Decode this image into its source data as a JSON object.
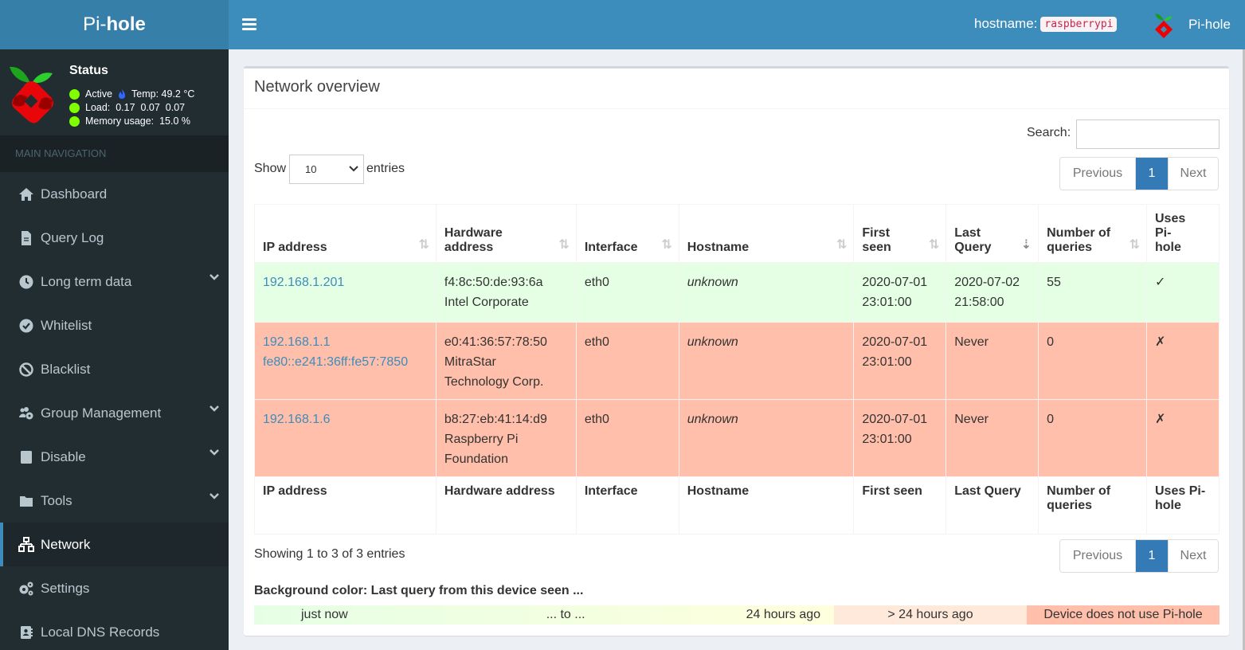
{
  "header": {
    "logo_prefix": "Pi-",
    "logo_bold": "hole",
    "hostname_label": "hostname:",
    "hostname_value": "raspberrypi",
    "user_name": "Pi-hole"
  },
  "status": {
    "title": "Status",
    "active": "Active",
    "temp": "Temp: 49.2 °C",
    "load": "Load:  0.17  0.07  0.07",
    "memory": "Memory usage:  15.0 %"
  },
  "sidebar": {
    "header": "MAIN NAVIGATION",
    "items": [
      {
        "label": "Dashboard",
        "icon": "home-icon",
        "chevron": false
      },
      {
        "label": "Query Log",
        "icon": "file-icon",
        "chevron": false
      },
      {
        "label": "Long term data",
        "icon": "clock-icon",
        "chevron": true
      },
      {
        "label": "Whitelist",
        "icon": "check-circle-icon",
        "chevron": false
      },
      {
        "label": "Blacklist",
        "icon": "ban-icon",
        "chevron": false
      },
      {
        "label": "Group Management",
        "icon": "users-cog-icon",
        "chevron": true
      },
      {
        "label": "Disable",
        "icon": "stop-icon",
        "chevron": true
      },
      {
        "label": "Tools",
        "icon": "folder-icon",
        "chevron": true
      },
      {
        "label": "Network",
        "icon": "network-icon",
        "chevron": false,
        "active": true
      },
      {
        "label": "Settings",
        "icon": "cogs-icon",
        "chevron": false
      },
      {
        "label": "Local DNS Records",
        "icon": "address-book-icon",
        "chevron": false
      }
    ]
  },
  "main": {
    "title": "Network overview",
    "search_label": "Search:",
    "search_value": "",
    "show_label": "Show",
    "entries_label": "entries",
    "page_length": "10",
    "pagination": {
      "previous": "Previous",
      "current": "1",
      "next": "Next"
    },
    "columns": [
      "IP address",
      "Hardware address",
      "Interface",
      "Hostname",
      "First seen",
      "Last Query",
      "Number of queries",
      "Uses Pi-hole"
    ],
    "sorted_column": "Last Query",
    "rows": [
      {
        "status": "recent",
        "ip": [
          "192.168.1.201"
        ],
        "hw": [
          "f4:8c:50:de:93:6a",
          "Intel Corporate"
        ],
        "iface": "eth0",
        "host": "unknown",
        "first": [
          "2020-07-01",
          "23:01:00"
        ],
        "last": [
          "2020-07-02",
          "21:58:00"
        ],
        "count": "55",
        "uses": "✓"
      },
      {
        "status": "none",
        "ip": [
          "192.168.1.1",
          "fe80::e241:36ff:fe57:7850"
        ],
        "hw": [
          "e0:41:36:57:78:50",
          "MitraStar",
          "Technology Corp."
        ],
        "iface": "eth0",
        "host": "unknown",
        "first": [
          "2020-07-01",
          "23:01:00"
        ],
        "last": [
          "Never"
        ],
        "count": "0",
        "uses": "✗"
      },
      {
        "status": "none",
        "ip": [
          "192.168.1.6"
        ],
        "hw": [
          "b8:27:eb:41:14:d9",
          "Raspberry Pi",
          "Foundation"
        ],
        "iface": "eth0",
        "host": "unknown",
        "first": [
          "2020-07-01",
          "23:01:00"
        ],
        "last": [
          "Never"
        ],
        "count": "0",
        "uses": "✗"
      }
    ],
    "info": "Showing 1 to 3 of 3 entries",
    "legend_title": "Background color: Last query from this device seen ...",
    "legend": {
      "just_now": "just now",
      "to": "... to ...",
      "day": "24 hours ago",
      "over": "> 24 hours ago",
      "none": "Device does not use Pi-hole"
    },
    "colors": {
      "recent": "#e5ffe5",
      "none": "#ffbfaa",
      "over": "#ffe9da",
      "accent": "#3c8dbc"
    }
  }
}
